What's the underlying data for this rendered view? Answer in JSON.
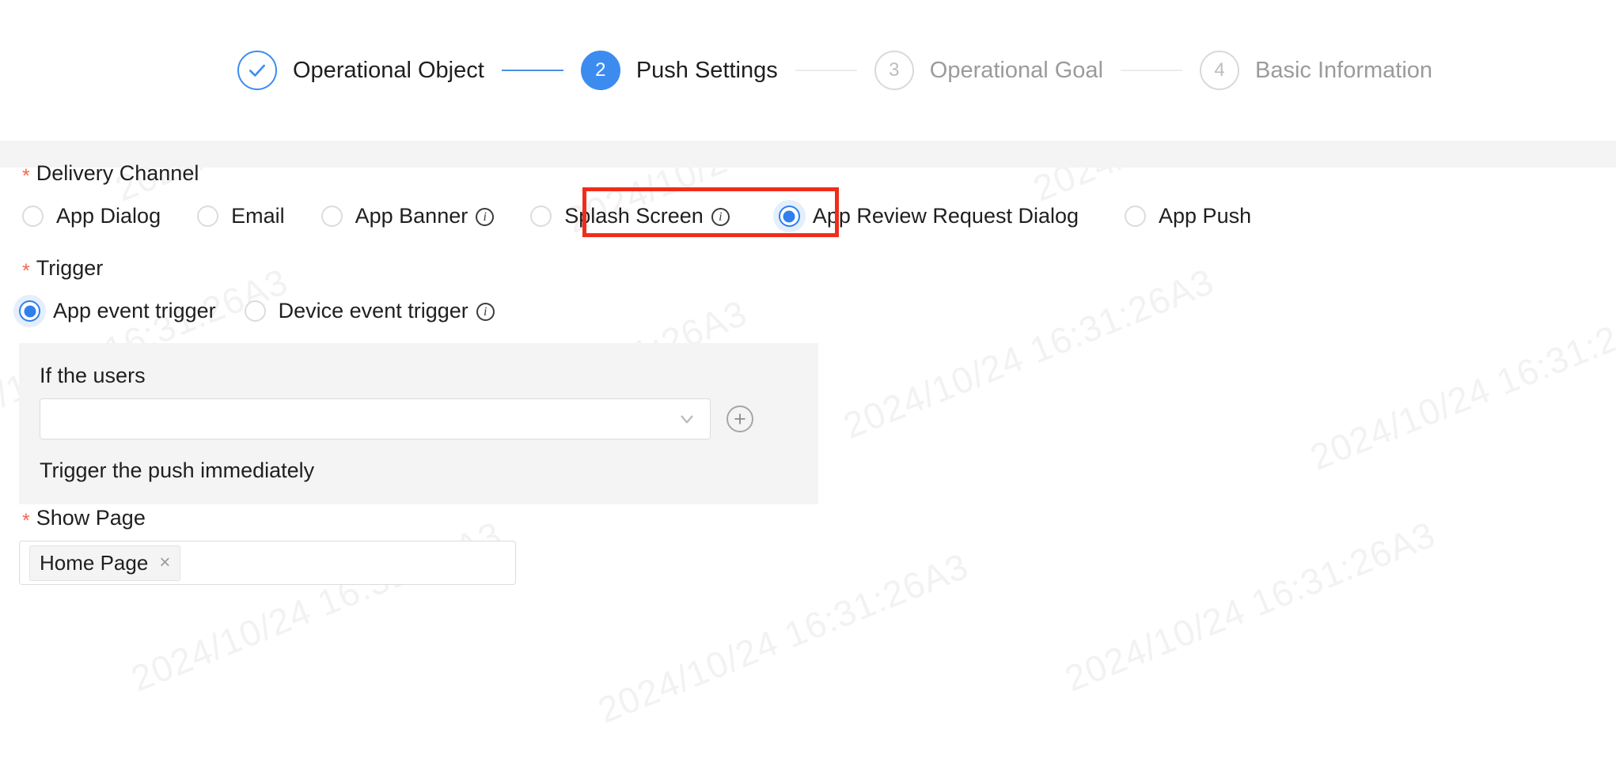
{
  "stepper": {
    "steps": [
      {
        "indicator": "check-icon",
        "label": "Operational Object",
        "state": "done"
      },
      {
        "indicator": "2",
        "label": "Push Settings",
        "state": "active"
      },
      {
        "indicator": "3",
        "label": "Operational Goal",
        "state": "todo"
      },
      {
        "indicator": "4",
        "label": "Basic Information",
        "state": "todo"
      }
    ],
    "accent_done": "#3c8cf0",
    "accent_active": "#3c8cf0",
    "line_blue": "#4a90e2",
    "line_grey": "#ececec"
  },
  "watermark": {
    "text": "2024/10/24 16:31:26A3"
  },
  "form": {
    "delivery_channel": {
      "label": "Delivery Channel",
      "required_marker": "*",
      "options": [
        {
          "label": "App Dialog",
          "checked": false,
          "info": false
        },
        {
          "label": "Email",
          "checked": false,
          "info": false
        },
        {
          "label": "App Banner",
          "checked": false,
          "info": true
        },
        {
          "label": "Splash Screen",
          "checked": false,
          "info": true
        },
        {
          "label": "App Review Request Dialog",
          "checked": true,
          "info": false
        },
        {
          "label": "App Push",
          "checked": false,
          "info": false
        }
      ],
      "highlight_color": "#ef2d1a",
      "highlighted_option": "App Review Request Dialog"
    },
    "trigger": {
      "label": "Trigger",
      "required_marker": "*",
      "options": [
        {
          "label": "App event trigger",
          "checked": true,
          "info": false
        },
        {
          "label": "Device event trigger",
          "checked": false,
          "info": true
        }
      ]
    },
    "condition_panel": {
      "title": "If the users",
      "select_value": "",
      "select_placeholder": "",
      "add_button": "add-condition",
      "note": "Trigger the push immediately"
    },
    "show_page": {
      "label": "Show Page",
      "required_marker": "*",
      "tags": [
        {
          "label": "Home Page",
          "close": "×"
        }
      ]
    }
  }
}
